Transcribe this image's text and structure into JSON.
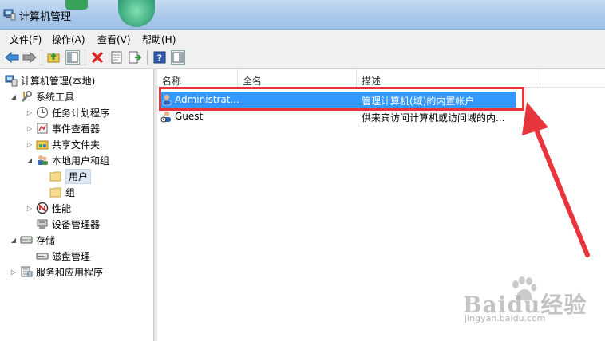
{
  "window": {
    "title": "计算机管理"
  },
  "menu": {
    "file": "文件(F)",
    "action": "操作(A)",
    "view": "查看(V)",
    "help": "帮助(H)"
  },
  "toolbar": {
    "back_icon": "back-arrow-icon",
    "forward_icon": "forward-arrow-icon",
    "up_icon": "up-folder-icon",
    "show_tree_icon": "show-hide-tree-icon",
    "delete_icon": "delete-x-icon",
    "properties_icon": "properties-icon",
    "export_icon": "export-list-icon",
    "help_icon": "help-icon",
    "action_pane_icon": "action-pane-icon"
  },
  "tree": {
    "root": "计算机管理(本地)",
    "system_tools": "系统工具",
    "task_scheduler": "任务计划程序",
    "event_viewer": "事件查看器",
    "shared_folders": "共享文件夹",
    "local_users_groups": "本地用户和组",
    "users": "用户",
    "groups": "组",
    "performance": "性能",
    "device_manager": "设备管理器",
    "storage": "存储",
    "disk_management": "磁盘管理",
    "services_apps": "服务和应用程序"
  },
  "list": {
    "columns": {
      "name": "名称",
      "fullname": "全名",
      "description": "描述"
    },
    "rows": [
      {
        "name": "Administrat...",
        "fullname": "",
        "description": "管理计算机(域)的内置帐户",
        "selected": true
      },
      {
        "name": "Guest",
        "fullname": "",
        "description": "供来宾访问计算机或访问域的内...",
        "selected": false
      }
    ]
  },
  "annotation": {
    "highlight_color": "#e8343b"
  },
  "watermark": {
    "logo": "Baidu经验",
    "url": "jingyan.baidu.com"
  }
}
